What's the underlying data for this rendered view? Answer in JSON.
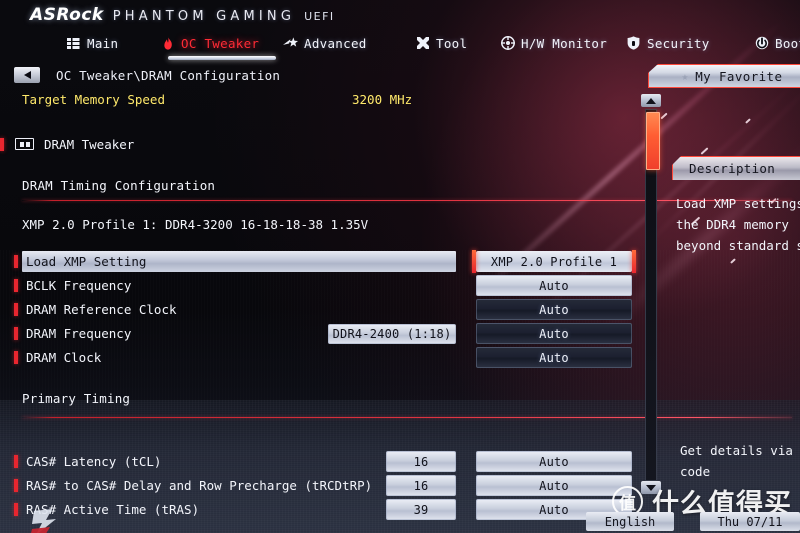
{
  "brand": {
    "vendor": "ASRock",
    "product_line": "PHANTOM GAMING",
    "firmware": "UEFI"
  },
  "nav": {
    "items": [
      {
        "label": "Main",
        "icon": "grid-icon",
        "active": false
      },
      {
        "label": "OC Tweaker",
        "icon": "flame-icon",
        "active": true
      },
      {
        "label": "Advanced",
        "icon": "star-arrow-icon",
        "active": false
      },
      {
        "label": "Tool",
        "icon": "wrench-cross-icon",
        "active": false
      },
      {
        "label": "H/W Monitor",
        "icon": "target-icon",
        "active": false
      },
      {
        "label": "Security",
        "icon": "shield-icon",
        "active": false
      },
      {
        "label": "Boot",
        "icon": "power-icon",
        "active": false
      }
    ]
  },
  "breadcrumb": {
    "back_icon": "back-triangle-icon",
    "path": "OC Tweaker\\DRAM Configuration"
  },
  "target_memory_speed": {
    "label": "Target Memory Speed",
    "value": "3200 MHz"
  },
  "dram_tweaker": {
    "label": "DRAM Tweaker",
    "icon": "dimm-module-icon"
  },
  "sections": {
    "timing_config": {
      "heading": "DRAM Timing Configuration",
      "xmp_profile_line": "XMP 2.0 Profile 1: DDR4-3200 16-18-18-38 1.35V"
    },
    "primary_timing": {
      "heading": "Primary Timing"
    }
  },
  "settings_rows": [
    {
      "label": "Load XMP Setting",
      "value": "XMP 2.0 Profile 1",
      "state": "selected",
      "row_highlight": true,
      "sub_value": null,
      "num_value": null
    },
    {
      "label": "BCLK Frequency",
      "value": "Auto",
      "state": "light",
      "row_highlight": false,
      "sub_value": null,
      "num_value": null
    },
    {
      "label": "DRAM Reference Clock",
      "value": "Auto",
      "state": "dark",
      "row_highlight": false,
      "sub_value": null,
      "num_value": null
    },
    {
      "label": "DRAM Frequency",
      "value": "Auto",
      "state": "dark",
      "row_highlight": false,
      "sub_value": "DDR4-2400 (1:18)",
      "num_value": null
    },
    {
      "label": "DRAM Clock",
      "value": "Auto",
      "state": "dark",
      "row_highlight": false,
      "sub_value": null,
      "num_value": null
    }
  ],
  "timing_rows": [
    {
      "label": "CAS# Latency (tCL)",
      "num_value": "16",
      "value": "Auto",
      "state": "light"
    },
    {
      "label": "RAS# to CAS# Delay and Row Precharge (tRCDtRP)",
      "num_value": "16",
      "value": "Auto",
      "state": "light"
    },
    {
      "label": "RAS# Active Time (tRAS)",
      "num_value": "39",
      "value": "Auto",
      "state": "light"
    }
  ],
  "my_favorite": {
    "label": "My Favorite",
    "icon": "star-icon"
  },
  "description": {
    "heading": "Description",
    "lines": [
      "Load XMP settings",
      "the DDR4 memory",
      "beyond standard s"
    ]
  },
  "qr_hint": {
    "lines": [
      "Get details via",
      "code"
    ]
  },
  "scrollbar": {
    "up_icon": "scroll-up-icon",
    "down_icon": "scroll-down-icon"
  },
  "bottom_bar": {
    "language": "English",
    "datetime": "Thu 07/11"
  },
  "watermark": {
    "mark": "值",
    "text": "什么值得买"
  },
  "colors": {
    "accent_red": "#e8262f",
    "accent_orange": "#ff5e33",
    "highlight_yellow": "#ffe96b",
    "panel_light": "#c9cfdd"
  }
}
